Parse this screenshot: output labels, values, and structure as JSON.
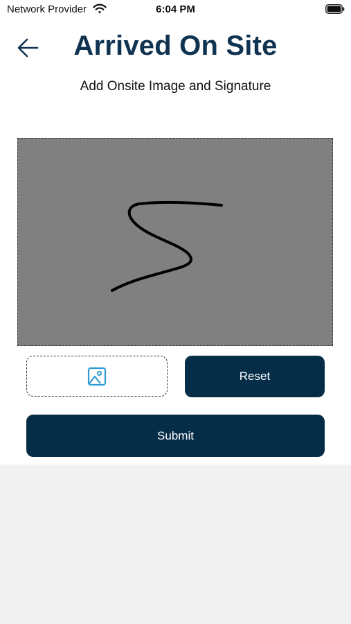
{
  "status_bar": {
    "carrier": "Network Provider",
    "time": "6:04 PM",
    "icons": [
      "wifi-icon",
      "battery-icon"
    ]
  },
  "header": {
    "back_icon": "arrow-left-icon",
    "title": "Arrived On Site",
    "subtitle": "Add Onsite Image and Signature"
  },
  "signature_pad": {
    "has_signature": true
  },
  "actions": {
    "image_icon": "image-icon",
    "reset_label": "Reset",
    "submit_label": "Submit"
  },
  "colors": {
    "title": "#0f3350",
    "button_bg": "#062d47",
    "pad_bg": "#808080",
    "icon_accent": "#2a9bd4",
    "lower_bg": "#f1f1f1"
  }
}
